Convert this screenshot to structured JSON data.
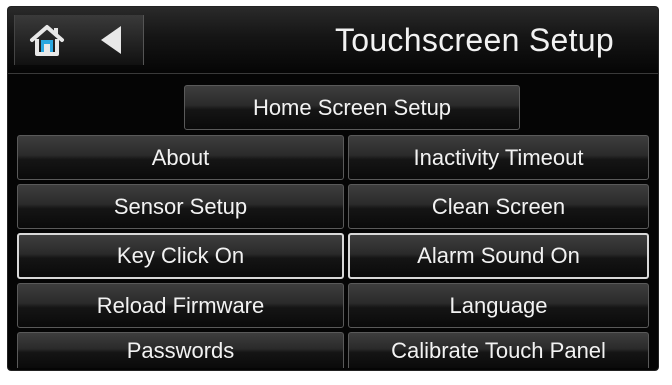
{
  "header": {
    "title": "Touchscreen Setup",
    "home_icon": "home-icon",
    "back_icon": "back-arrow-icon"
  },
  "buttons": {
    "home_screen_setup": "Home Screen Setup",
    "about": "About",
    "inactivity_timeout": "Inactivity Timeout",
    "sensor_setup": "Sensor Setup",
    "clean_screen": "Clean Screen",
    "key_click": "Key Click On",
    "alarm_sound": "Alarm Sound On",
    "reload_firmware": "Reload Firmware",
    "language": "Language",
    "passwords": "Passwords",
    "calibrate_touch_panel": "Calibrate Touch Panel"
  },
  "colors": {
    "screen_bg": "#050505",
    "text": "#f2f2f2",
    "home_icon_accent": "#2aa7e0",
    "active_border": "#d8d8d8"
  }
}
